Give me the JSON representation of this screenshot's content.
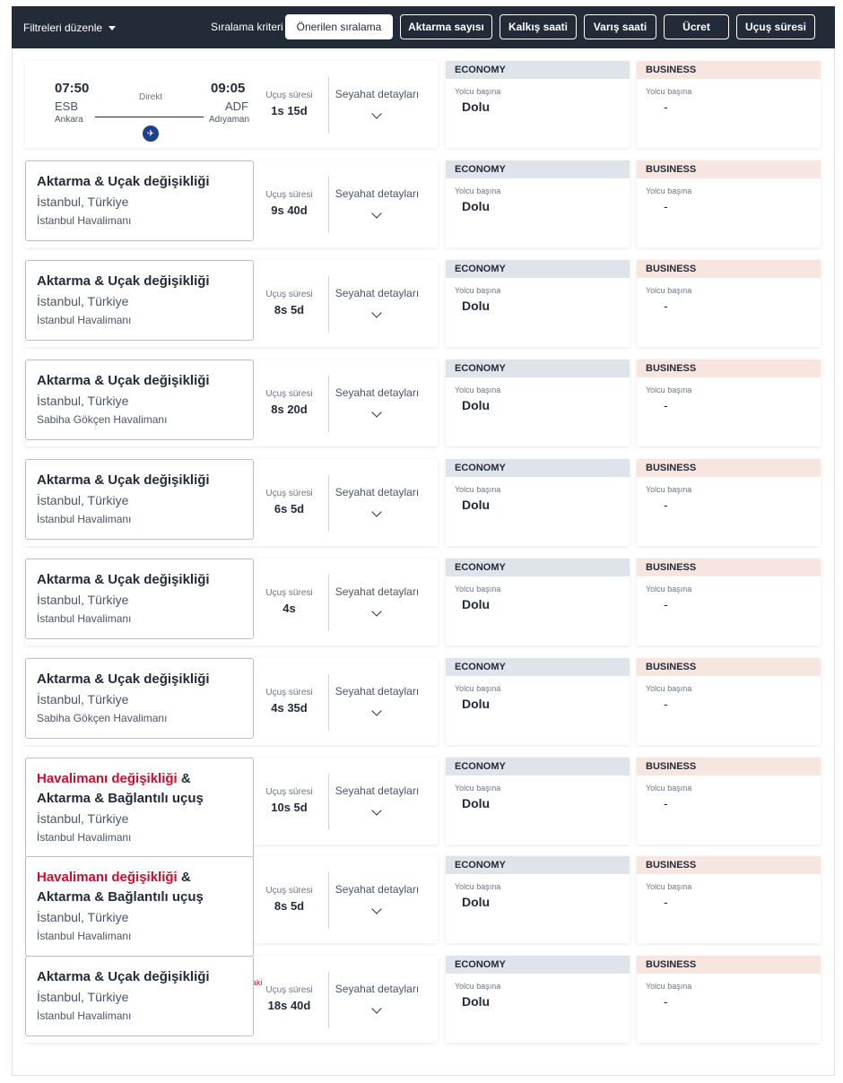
{
  "toolbar": {
    "filter_edit_label": "Filtreleri düzenle",
    "sort_label": "Sıralama kriteri",
    "sort_options": [
      "Önerilen sıralama",
      "Aktarma sayısı",
      "Kalkış saati",
      "Varış saati",
      "Ücret",
      "Uçuş süresi"
    ],
    "active_sort": "Önerilen sıralama"
  },
  "common": {
    "duration_label": "Uçuş süresi",
    "details_label": "Seyahat detayları",
    "economy_label": "ECONOMY",
    "business_label": "BUSINESS",
    "per_passenger": "Yolcu başına",
    "economy_value": "Dolu",
    "business_value": "-"
  },
  "direct_flight": {
    "dep_time": "07:50",
    "dep_code": "ESB",
    "dep_city": "Ankara",
    "arr_time": "09:05",
    "arr_code": "ADF",
    "arr_city": "Adıyaman",
    "direct_label": "Direkt",
    "duration": "1s 15d",
    "airline_icon": "turkish-airlines-logo"
  },
  "flights": [
    {
      "title": "Aktarma & Uçak değişikliği",
      "city": "İstanbul, Türkiye",
      "airport": "İstanbul Havalimanı",
      "duration": "9s 40d"
    },
    {
      "title": "Aktarma & Uçak değişikliği",
      "city": "İstanbul, Türkiye",
      "airport": "İstanbul Havalimanı",
      "duration": "8s 5d"
    },
    {
      "title": "Aktarma & Uçak değişikliği",
      "city": "İstanbul, Türkiye",
      "airport": "Sabiha Gökçen Havalimanı",
      "duration": "8s 20d"
    },
    {
      "title": "Aktarma & Uçak değişikliği",
      "city": "İstanbul, Türkiye",
      "airport": "İstanbul Havalimanı",
      "duration": "6s 5d"
    },
    {
      "title": "Aktarma & Uçak değişikliği",
      "city": "İstanbul, Türkiye",
      "airport": "İstanbul Havalimanı",
      "duration": "4s"
    },
    {
      "title": "Aktarma & Uçak değişikliği",
      "city": "İstanbul, Türkiye",
      "airport": "Sabiha Gökçen Havalimanı",
      "duration": "4s 35d"
    },
    {
      "title_red": "Havalimanı değişikliği",
      "title_amp": " &",
      "title_line2": "Aktarma & Bağlantılı uçuş",
      "city": "İstanbul, Türkiye",
      "airport": "İstanbul Havalimanı",
      "duration": "10s 5d"
    },
    {
      "title_red": "Havalimanı değişikliği",
      "title_amp": " &",
      "title_line2": "Aktarma & Bağlantılı uçuş",
      "city": "İstanbul, Türkiye",
      "airport": "İstanbul Havalimanı",
      "duration": "8s 5d"
    },
    {
      "title": "Aktarma & Uçak değişikliği",
      "city": "İstanbul, Türkiye",
      "airport": "İstanbul Havalimanı",
      "duration": "18s 40d",
      "extra_note": "raki"
    }
  ],
  "colors": {
    "topbar": "#232b38",
    "economy_header": "#dfe3ea",
    "business_header": "#f7e6e0",
    "alert_red": "#c8102e"
  }
}
